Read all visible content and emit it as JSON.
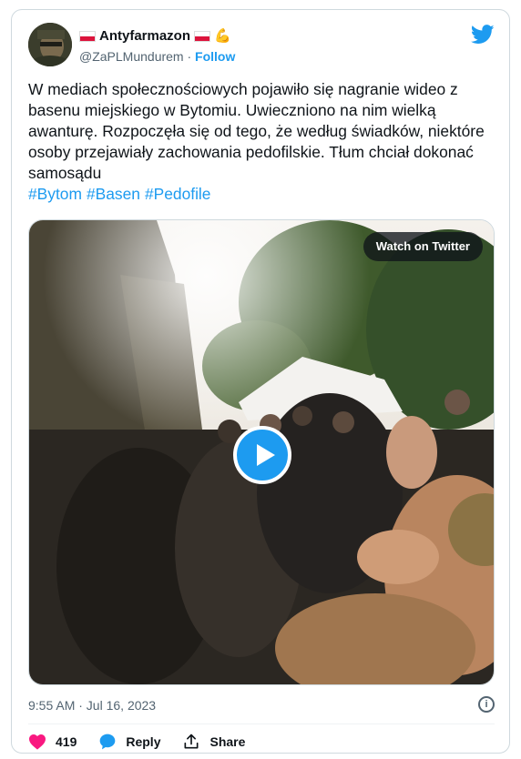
{
  "author": {
    "display_name": "Antyfarmazon",
    "handle": "@ZaPLMundurem",
    "separator": "·",
    "follow_label": "Follow",
    "muscle_emoji": "💪"
  },
  "tweet": {
    "text": "W mediach społecznościowych pojawiło się nagranie wideo z basenu miejskiego w Bytomiu. Uwieczniono na nim wielką awanturę. Rozpoczęła się od tego, że według świadków, niektóre osoby przejawiały zachowania pedofilskie. Tłum chciał dokonać samosądu",
    "hashtags": [
      "#Bytom",
      "#Basen",
      "#Pedofile"
    ]
  },
  "media": {
    "watch_label": "Watch on Twitter"
  },
  "meta": {
    "timestamp": "9:55 AM · Jul 16, 2023",
    "info_symbol": "i"
  },
  "actions": {
    "like_count": "419",
    "reply_label": "Reply",
    "share_label": "Share"
  },
  "colors": {
    "accent": "#1d9bf0",
    "like": "#f91880",
    "secondary_text": "#536471",
    "border": "#cfd9de"
  }
}
